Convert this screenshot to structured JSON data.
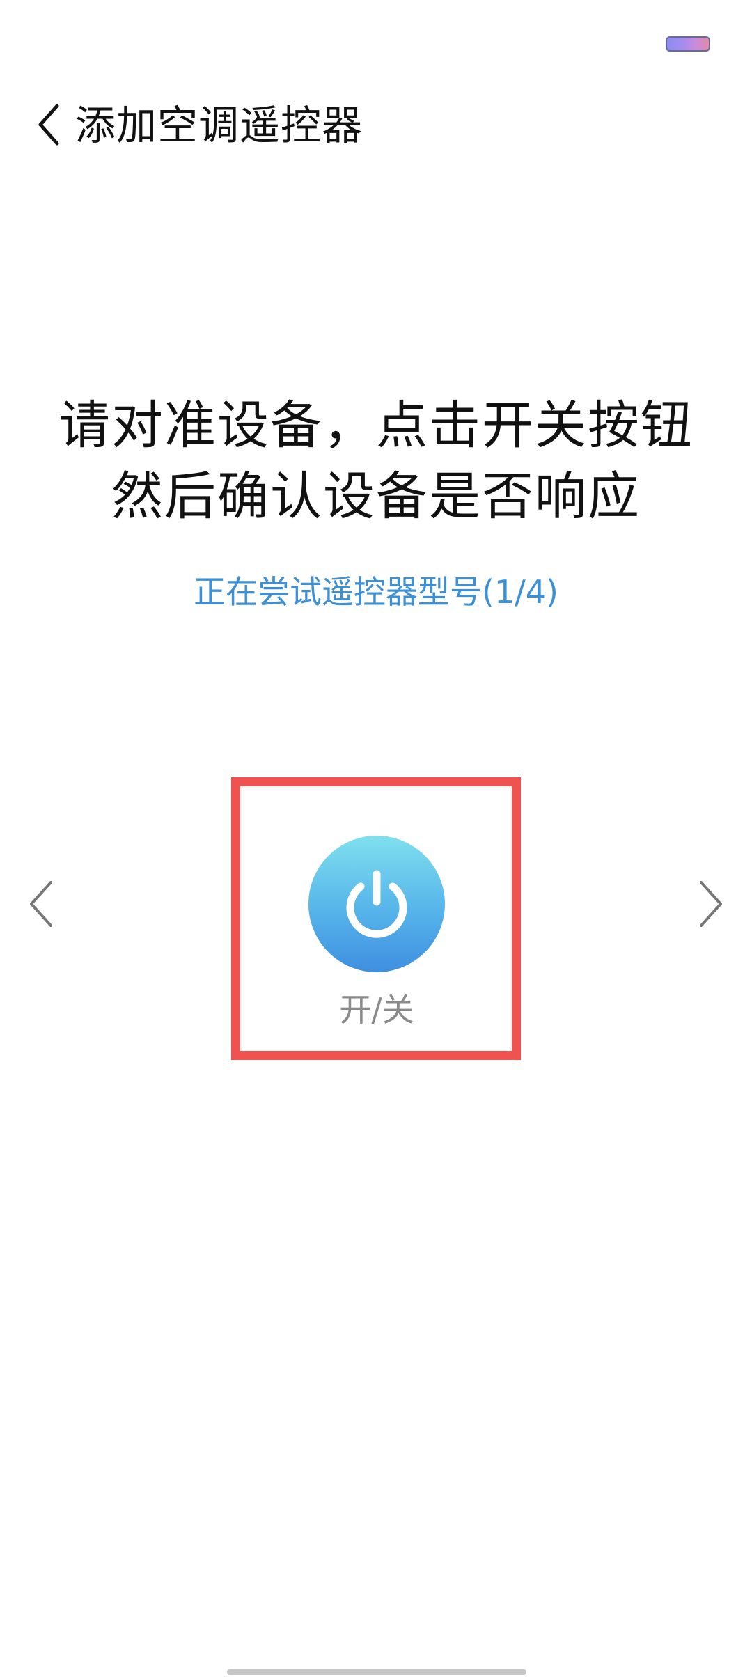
{
  "status_bar": {
    "indicator_icon": "battery-indicator"
  },
  "header": {
    "back_icon": "chevron-left-icon",
    "title": "添加空调遥控器"
  },
  "instruction": {
    "line1": "请对准设备，点击开关按钮",
    "line2": "然后确认设备是否响应"
  },
  "status_text": "正在尝试遥控器型号(1/4)",
  "navigation": {
    "prev_icon": "chevron-left-icon",
    "next_icon": "chevron-right-icon"
  },
  "power_button": {
    "icon": "power-icon",
    "label": "开/关"
  },
  "colors": {
    "accent": "#3d8fd6",
    "highlight_border": "#ef5350",
    "power_gradient_top": "#7fe0ee",
    "power_gradient_bottom": "#3f8fe0",
    "label_gray": "#8a8a8a"
  }
}
